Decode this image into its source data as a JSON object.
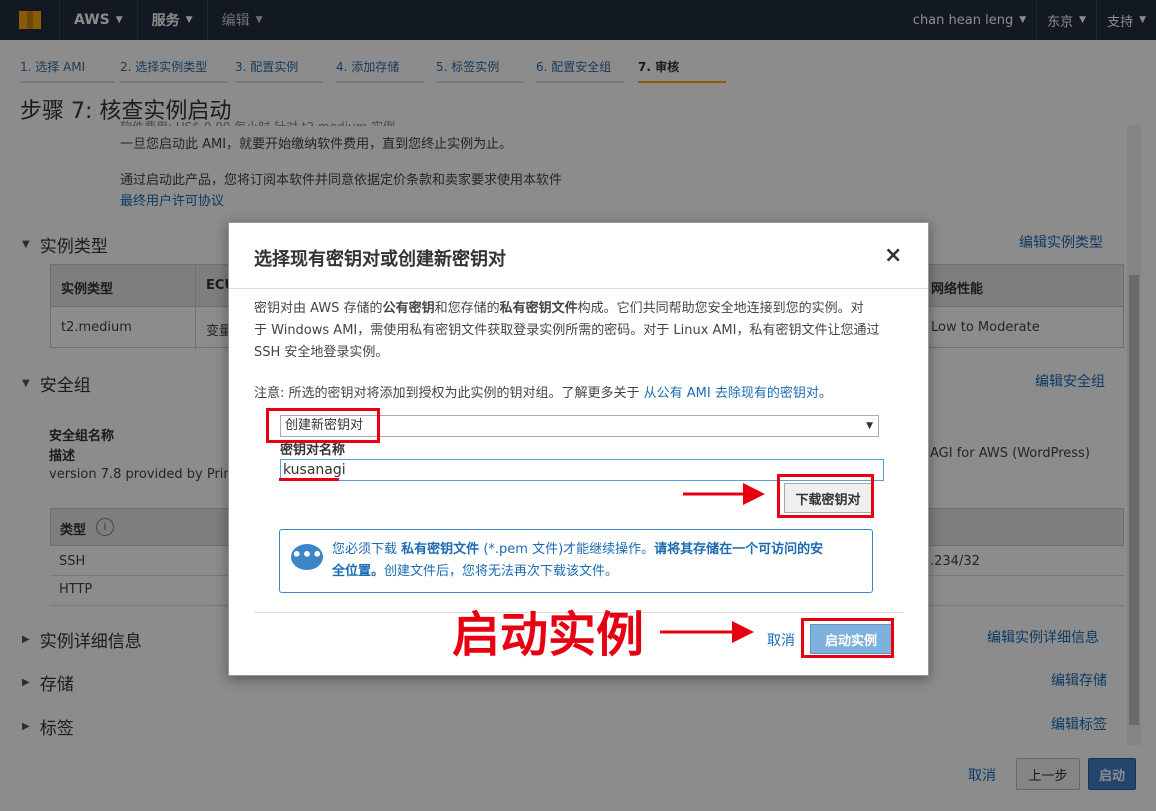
{
  "topnav": {
    "brand": "AWS",
    "services": "服务",
    "edit": "编辑",
    "user": "chan hean leng",
    "region": "东京",
    "support": "支持"
  },
  "steps": [
    "1. 选择 AMI",
    "2. 选择实例类型",
    "3. 配置实例",
    "4. 添加存储",
    "5. 标签实例",
    "6. 配置安全组",
    "7. 审核"
  ],
  "page": {
    "title": "步骤 7: 核查实例启动",
    "partial_line": "软件费用: US$ 0.00 每小时 针对 t2.medium 实例",
    "line1": "一旦您启动此 AMI，就要开始缴纳软件费用，直到您终止实例为止。",
    "line2": "通过启动此产品，您将订阅本软件并同意依据定价条款和卖家要求使用本软件",
    "eula_link": "最终用户许可协议"
  },
  "instance_type": {
    "heading": "实例类型",
    "edit": "编辑实例类型",
    "headers": [
      "实例类型",
      "ECU",
      "网络性能"
    ],
    "row": [
      "t2.medium",
      "变量",
      "Low to Moderate"
    ]
  },
  "security_group": {
    "heading": "安全组",
    "edit": "编辑安全组",
    "name_label": "安全组名称",
    "desc_label": "描述",
    "desc_value": "version 7.8 provided by Prim",
    "desc_value_right": "AGI for AWS (WordPress)",
    "col_type": "类型",
    "rows": [
      {
        "type": "SSH",
        "source": ".234/32"
      },
      {
        "type": "HTTP",
        "source": ""
      }
    ]
  },
  "sections": {
    "details": {
      "heading": "实例详细信息",
      "edit": "编辑实例详细信息"
    },
    "storage": {
      "heading": "存储",
      "edit": "编辑存储"
    },
    "tags": {
      "heading": "标签",
      "edit": "编辑标签"
    }
  },
  "footer": {
    "cancel": "取消",
    "previous": "上一步",
    "launch": "启动"
  },
  "modal": {
    "title": "选择现有密钥对或创建新密钥对",
    "close": "×",
    "para_l1_a": "密钥对由 AWS 存储的",
    "para_l1_b": "公有密钥",
    "para_l1_c": "和您存储的",
    "para_l1_d": "私有密钥文件",
    "para_l1_e": "构成。它们共同帮助您安全地连接到您的实例。对",
    "para_l2": "于 Windows AMI，需使用私有密钥文件获取登录实例所需的密码。对于 Linux AMI，私有密钥文件让您通过",
    "para_l3": "SSH 安全地登录实例。",
    "note_text": "注意: 所选的密钥对将添加到授权为此实例的钥对组。了解更多关于",
    "note_link": "从公有 AMI 去除现有的密钥对",
    "note_end": "。",
    "select_value": "创建新密钥对",
    "keypair_label": "密钥对名称",
    "keypair_value": "kusanagi",
    "download_button": "下载密钥对",
    "info_l1_a": "您必须下载",
    "info_l1_b": "私有密钥文件",
    "info_l1_c": "(*.pem 文件)才能继续操作。",
    "info_l1_d": "请将其存储在一个可访问的安",
    "info_l2_a": "全位置。",
    "info_l2_b": "创建文件后，您将无法再次下载该文件。",
    "cancel": "取消",
    "launch": "启动实例"
  },
  "annotation": {
    "big_text": "启动实例",
    "color": "#e60012"
  }
}
